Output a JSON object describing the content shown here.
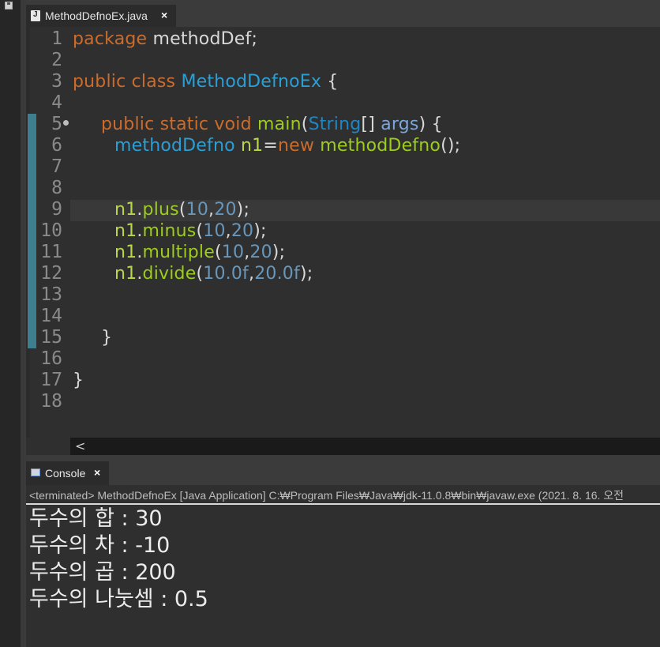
{
  "editor_tab": {
    "label": "MethodDefnoEx.java",
    "close": "×"
  },
  "line_numbers": [
    "1",
    "2",
    "3",
    "4",
    "5",
    "6",
    "7",
    "8",
    "9",
    "10",
    "11",
    "12",
    "13",
    "14",
    "15",
    "16",
    "17",
    "18"
  ],
  "code": {
    "l1": {
      "a": "package",
      "b": " methodDef;"
    },
    "l3": {
      "a": "public",
      "b": " ",
      "c": "class",
      "d": " ",
      "e": "MethodDefnoEx",
      "f": " {"
    },
    "l5": {
      "a": "public",
      "b": " ",
      "c": "static",
      "d": " ",
      "e": "void",
      "f": " ",
      "g": "main",
      "h": "(",
      "i": "String",
      "j": "[] ",
      "k": "args",
      "l": ") {"
    },
    "l6": {
      "a": "methodDefno",
      "b": " ",
      "c": "n1",
      "d": "=",
      "e": "new",
      "f": " ",
      "g": "methodDefno",
      "h": "();"
    },
    "l9": {
      "a": "n1",
      "b": ".",
      "c": "plus",
      "d": "(",
      "e": "10",
      "f": ",",
      "g": "20",
      "h": ");"
    },
    "l10": {
      "a": "n1",
      "b": ".",
      "c": "minus",
      "d": "(",
      "e": "10",
      "f": ",",
      "g": "20",
      "h": ");"
    },
    "l11": {
      "a": "n1",
      "b": ".",
      "c": "multiple",
      "d": "(",
      "e": "10",
      "f": ",",
      "g": "20",
      "h": ");"
    },
    "l12": {
      "a": "n1",
      "b": ".",
      "c": "divide",
      "d": "(",
      "e": "10.0f",
      "f": ",",
      "g": "20.0f",
      "h": ");"
    },
    "l15": {
      "a": "}"
    },
    "l17": {
      "a": "}"
    }
  },
  "hscroll": {
    "left_arrow": "<"
  },
  "console": {
    "tab_label": "Console",
    "close": "×",
    "status": "<terminated> MethodDefnoEx [Java Application] C:₩Program Files₩Java₩jdk-11.0.8₩bin₩javaw.exe  (2021. 8. 16. 오전",
    "output": [
      "두수의 합 : 30",
      "두수의 차 : -10",
      "두수의 곱 : 200",
      "두수의 나눗셈 : 0.5"
    ]
  },
  "colors": {
    "keyword": "#cc6c2c",
    "class_name": "#2a9fd6",
    "method": "#9ccc1c",
    "number": "#6897bb",
    "background": "#2f2f2f"
  }
}
